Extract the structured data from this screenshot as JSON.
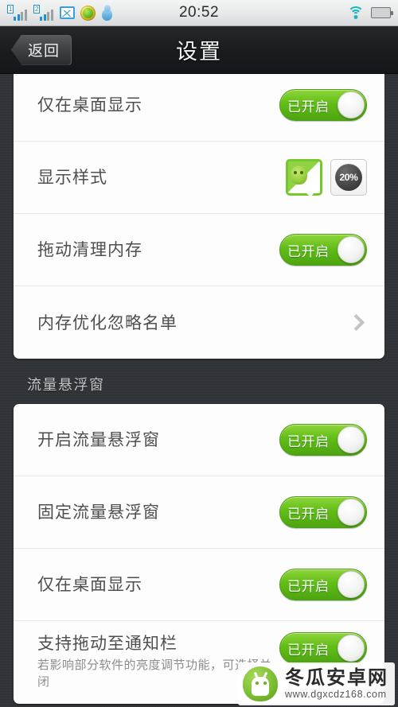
{
  "status_bar": {
    "clock": "20:52",
    "left_icons": [
      {
        "name": "signal-sim1-icon",
        "sim_label": "1"
      },
      {
        "name": "signal-sim2-icon",
        "sim_label": "2"
      },
      {
        "name": "gallery-icon"
      },
      {
        "name": "green-ball-icon"
      },
      {
        "name": "qq-penguin-icon"
      }
    ],
    "right_icons": [
      {
        "name": "wifi-icon"
      },
      {
        "name": "battery-icon"
      }
    ]
  },
  "nav_bar": {
    "back_label": "返回",
    "title": "设置"
  },
  "colors": {
    "accent_green": "#62bd18",
    "background_dark": "#2f3337",
    "card_white": "#fdfdfd",
    "row_text": "#4e4e4e",
    "sub_text": "#8d8d8d",
    "section_header": "#c5c9cb"
  },
  "cards": [
    {
      "id": "memory-card",
      "clipped_top": true,
      "rows": [
        {
          "name": "row-desktop-only",
          "title": "仅在桌面显示",
          "control": "toggle",
          "toggle_label": "已开启",
          "toggle_on": true
        },
        {
          "name": "row-display-style",
          "title": "显示样式",
          "control": "style-picker",
          "styles": [
            {
              "name": "style-tile-mascot",
              "selected": true,
              "label": ""
            },
            {
              "name": "style-tile-percent",
              "selected": false,
              "label": "20%"
            }
          ]
        },
        {
          "name": "row-drag-clean-memory",
          "title": "拖动清理内存",
          "control": "toggle",
          "toggle_label": "已开启",
          "toggle_on": true
        },
        {
          "name": "row-memory-ignore-list",
          "title": "内存优化忽略名单",
          "control": "chevron"
        }
      ]
    }
  ],
  "section": {
    "header": "流量悬浮窗",
    "card": {
      "id": "traffic-card",
      "rows": [
        {
          "name": "row-enable-traffic-float",
          "title": "开启流量悬浮窗",
          "control": "toggle",
          "toggle_label": "已开启",
          "toggle_on": true
        },
        {
          "name": "row-fix-traffic-float",
          "title": "固定流量悬浮窗",
          "control": "toggle",
          "toggle_label": "已开启",
          "toggle_on": true
        },
        {
          "name": "row-desktop-only-traffic",
          "title": "仅在桌面显示",
          "control": "toggle",
          "toggle_label": "已开启",
          "toggle_on": true
        },
        {
          "name": "row-drag-to-notification",
          "title": "支持拖动至通知栏",
          "subtitle": "若影响部分软件的亮度调节功能，可选择关闭",
          "control": "toggle",
          "toggle_label": "已开启",
          "toggle_on": true
        }
      ]
    }
  },
  "watermark": {
    "site_name": "冬瓜安卓网",
    "url": "www.dgxcdz168.com"
  }
}
